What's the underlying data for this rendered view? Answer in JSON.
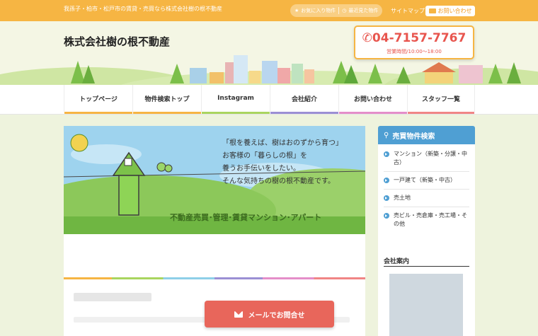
{
  "topbar": {
    "tagline": "我孫子・柏市・松戸市の賃貸・売買なら株式会社樹の根不動産",
    "favorites_label": "お気に入り物件",
    "recent_label": "最近見た物件",
    "sitemap_label": "サイトマップ",
    "contact_label": "お問い合わせ"
  },
  "header": {
    "logo": "株式会社樹の根不動産",
    "phone": "04-7157-7767",
    "hours": "営業時間/10:00〜18:00"
  },
  "nav": {
    "items": [
      {
        "label": "トップページ",
        "color": "#f6b543"
      },
      {
        "label": "物件検索トップ",
        "color": "#f6b543"
      },
      {
        "label": "Instagram",
        "color": "#a9d55e"
      },
      {
        "label": "会社紹介",
        "color": "#9b8fd4"
      },
      {
        "label": "お問い合わせ",
        "color": "#e48ec9"
      },
      {
        "label": "スタッフ一覧",
        "color": "#f08585"
      }
    ]
  },
  "hero": {
    "line1": "「根を養えば、樹はおのずから育つ」",
    "line2": "お客様の「暮らしの根」を",
    "line3": "養うお手伝いをしたい。",
    "line4": "そんな気持ちの樹の根不動産です。",
    "sub": "不動産売買･管理･賃貸マンション･アパート"
  },
  "sidebar": {
    "title": "売買物件検索",
    "items": [
      {
        "label": "マンション（新築・分譲・中古）"
      },
      {
        "label": "一戸建て（新築・中古）"
      },
      {
        "label": "売土地"
      },
      {
        "label": "売ビル・売倉庫・売工場・その他"
      }
    ]
  },
  "company": {
    "title": "会社案内"
  },
  "mail_button": {
    "label": "メールでお問合せ"
  },
  "colors": {
    "accent": "#f6b543",
    "sidebar_blue": "#4f9fd3",
    "cta_red": "#e8665b"
  }
}
